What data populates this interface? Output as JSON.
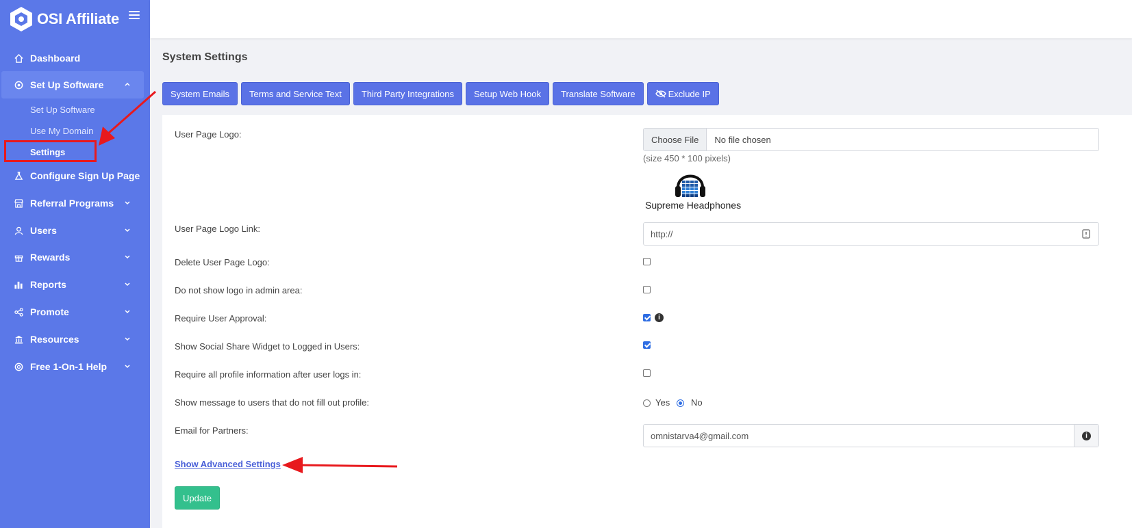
{
  "brand": {
    "name": "OSI Affiliate",
    "logo_icon": "hexagon-logo-icon",
    "menu_icon": "hamburger-icon"
  },
  "sidebar": {
    "items": [
      {
        "label": "Dashboard",
        "icon": "home-icon"
      },
      {
        "label": "Set Up Software",
        "icon": "cog-eye-icon",
        "expanded": true
      },
      {
        "label": "Configure Sign Up Page",
        "icon": "flask-icon"
      },
      {
        "label": "Referral Programs",
        "icon": "store-icon"
      },
      {
        "label": "Users",
        "icon": "user-icon"
      },
      {
        "label": "Rewards",
        "icon": "gift-icon"
      },
      {
        "label": "Reports",
        "icon": "bar-chart-icon"
      },
      {
        "label": "Promote",
        "icon": "share-icon"
      },
      {
        "label": "Resources",
        "icon": "bank-icon"
      },
      {
        "label": "Free 1-On-1 Help",
        "icon": "lifebuoy-icon"
      }
    ],
    "subitems": [
      {
        "label": "Set Up Software"
      },
      {
        "label": "Use My Domain"
      },
      {
        "label": "Settings",
        "current": true
      }
    ]
  },
  "page": {
    "title": "System Settings"
  },
  "tabs": [
    {
      "label": "System Emails"
    },
    {
      "label": "Terms and Service Text"
    },
    {
      "label": "Third Party Integrations"
    },
    {
      "label": "Setup Web Hook"
    },
    {
      "label": "Translate Software"
    },
    {
      "label": "Exclude IP",
      "icon": "eye-slash-icon"
    }
  ],
  "form": {
    "logo_label": "User Page Logo:",
    "file_button": "Choose File",
    "file_status": "No file chosen",
    "size_note": "(size 450 * 100 pixels)",
    "logo_preview_text": "Supreme Headphones",
    "logo_link_label": "User Page Logo Link:",
    "logo_link_value": "http://",
    "delete_logo_label": "Delete User Page Logo:",
    "delete_logo_checked": false,
    "no_admin_logo_label": "Do not show logo in admin area:",
    "no_admin_logo_checked": false,
    "require_approval_label": "Require User Approval:",
    "require_approval_checked": true,
    "social_widget_label": "Show Social Share Widget to Logged in Users:",
    "social_widget_checked": true,
    "require_profile_label": "Require all profile information after user logs in:",
    "require_profile_checked": false,
    "show_message_label": "Show message to users that do not fill out profile:",
    "radio_yes": "Yes",
    "radio_no": "No",
    "radio_selected": "No",
    "email_label": "Email for Partners:",
    "email_value": "omnistarva4@gmail.com",
    "advanced_link": "Show Advanced Settings",
    "update_button": "Update"
  },
  "colors": {
    "sidebar": "#5b78e8",
    "tab": "#5a72e6",
    "update": "#33c08d",
    "annotation": "#e8191d"
  }
}
